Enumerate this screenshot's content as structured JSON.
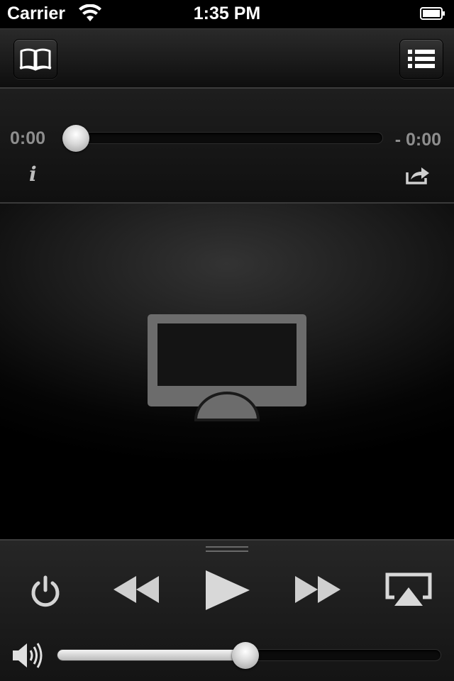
{
  "status_bar": {
    "carrier": "Carrier",
    "time": "1:35 PM",
    "wifi_icon": "wifi-icon",
    "battery_icon": "battery-icon"
  },
  "toolbar": {
    "left_icon": "book-icon",
    "right_icon": "list-icon"
  },
  "scrubber": {
    "elapsed": "0:00",
    "remaining": "- 0:00",
    "position": 0
  },
  "info": {
    "label": "i"
  },
  "video": {
    "placeholder_icon": "airplay-tv-icon"
  },
  "controls": {
    "icons": [
      "power-icon",
      "rewind-icon",
      "play-icon",
      "fast-forward-icon",
      "airplay-icon"
    ]
  },
  "volume": {
    "level": 0.49,
    "icon": "speaker-icon"
  },
  "colors": {
    "background": "#000000",
    "panel": "#1a1a1a",
    "text_dim": "#8e8e8e",
    "icon_gray": "#7a7a7a"
  }
}
